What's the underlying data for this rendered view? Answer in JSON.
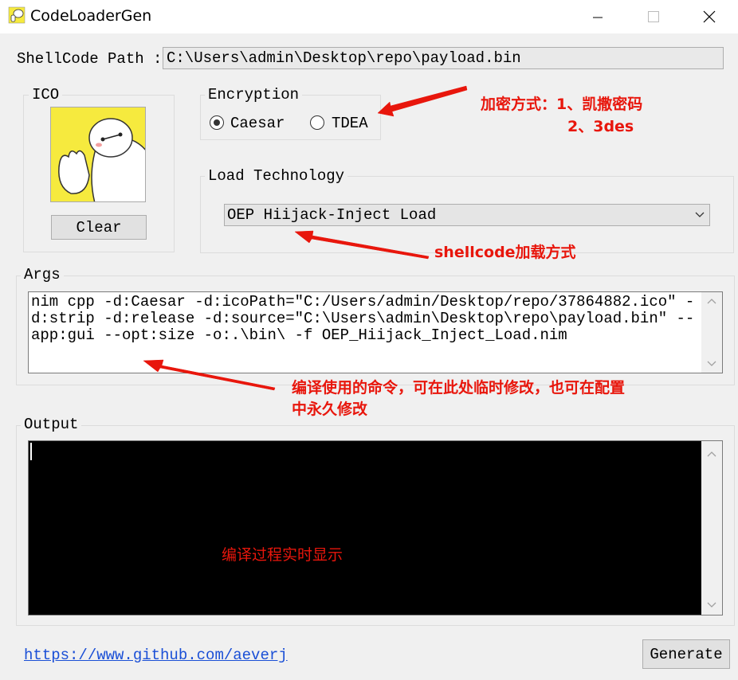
{
  "window": {
    "title": "CodeLoaderGen",
    "controls": [
      "minimize-icon",
      "maximize-icon",
      "close-icon"
    ]
  },
  "shellcode": {
    "label": "ShellCode Path :",
    "value": "C:\\Users\\admin\\Desktop\\repo\\payload.bin"
  },
  "ico": {
    "title": "ICO",
    "clear_label": "Clear"
  },
  "encryption": {
    "title": "Encryption",
    "options": [
      {
        "label": "Caesar",
        "selected": true
      },
      {
        "label": "TDEA",
        "selected": false
      }
    ]
  },
  "load": {
    "title": "Load Technology",
    "selected": "OEP Hiijack-Inject Load"
  },
  "args": {
    "title": "Args",
    "text": "nim cpp -d:Caesar -d:icoPath=\"C:/Users/admin/Desktop/repo/37864882.ico\" -\nd:strip -d:release -d:source=\"C:\\Users\\admin\\Desktop\\repo\\payload.bin\" --\napp:gui --opt:size -o:.\\bin\\ -f OEP_Hiijack_Inject_Load.nim"
  },
  "output": {
    "title": "Output"
  },
  "footer": {
    "link": "https://www.github.com/aeverj",
    "generate_label": "Generate"
  },
  "annotations": {
    "encryption_line1": "加密方式：1、凯撒密码",
    "encryption_line2": "2、3des",
    "load": "shellcode加载方式",
    "args_line1": "编译使用的命令，可在此处临时修改，也可在配置",
    "args_line2": "中永久修改",
    "output": "编译过程实时显示"
  },
  "colors": {
    "annotation": "#e8160c",
    "link": "#1a4fd6",
    "output_bg": "#000000"
  }
}
